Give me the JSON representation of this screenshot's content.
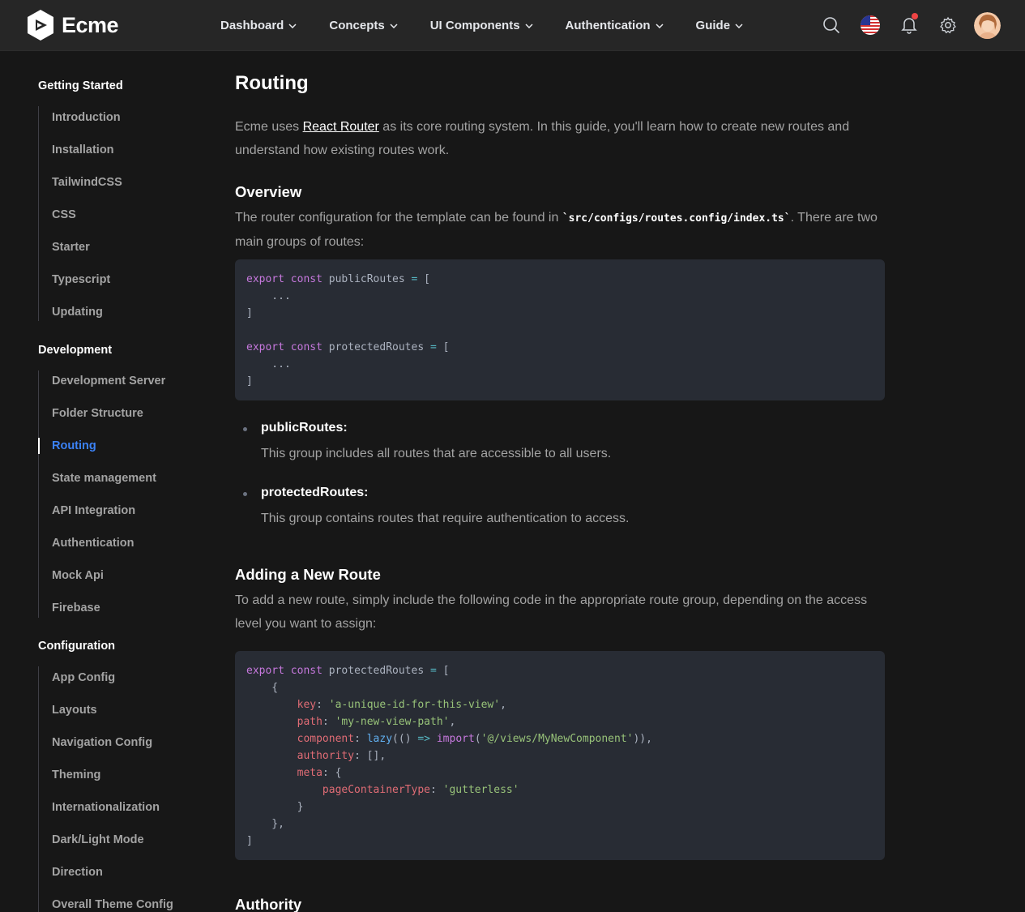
{
  "header": {
    "brand": "Ecme",
    "nav": [
      "Dashboard",
      "Concepts",
      "UI Components",
      "Authentication",
      "Guide"
    ],
    "icons": [
      "search-icon",
      "us-flag-icon",
      "bell-icon",
      "gear-icon",
      "avatar"
    ]
  },
  "sidebar": {
    "sections": [
      {
        "title": "Getting Started",
        "items": [
          "Introduction",
          "Installation",
          "TailwindCSS",
          "CSS",
          "Starter",
          "Typescript",
          "Updating"
        ]
      },
      {
        "title": "Development",
        "items": [
          "Development Server",
          "Folder Structure",
          "Routing",
          "State management",
          "API Integration",
          "Authentication",
          "Mock Api",
          "Firebase"
        ]
      },
      {
        "title": "Configuration",
        "items": [
          "App Config",
          "Layouts",
          "Navigation Config",
          "Theming",
          "Internationalization",
          "Dark/Light Mode",
          "Direction",
          "Overall Theme Config"
        ]
      }
    ],
    "active": "Routing"
  },
  "content": {
    "title": "Routing",
    "intro_pre": "Ecme uses ",
    "intro_link": "React Router",
    "intro_post": " as its core routing system. In this guide, you'll learn how to create new routes and understand how existing routes work.",
    "overview_title": "Overview",
    "overview_pre": "The router configuration for the template can be found in ",
    "overview_code": "`src/configs/routes.config/index.ts`",
    "overview_post": ". There are two main groups of routes:",
    "code1_lines": [
      "export const publicRoutes = [",
      "    ...",
      "]",
      "",
      "export const protectedRoutes = [",
      "    ...",
      "]"
    ],
    "bullets": [
      {
        "title": "publicRoutes:",
        "text": "This group includes all routes that are accessible to all users."
      },
      {
        "title": "protectedRoutes:",
        "text": "This group contains routes that require authentication to access."
      }
    ],
    "new_route_title": "Adding a New Route",
    "new_route_text": "To add a new route, simply include the following code in the appropriate route group, depending on the access level you want to assign:",
    "code2_lines": [
      "export const protectedRoutes = [",
      "    {",
      "        key: 'a-unique-id-for-this-view',",
      "        path: 'my-new-view-path',",
      "        component: lazy(() => import('@/views/MyNewComponent')),",
      "        authority: [],",
      "        meta: {",
      "            pageContainerType: 'gutterless'",
      "        }",
      "    },",
      "]"
    ],
    "authority_title": "Authority"
  },
  "colors": {
    "background": "#171717",
    "header": "#262626",
    "code_bg": "#282c34",
    "active_link": "#3b82f6",
    "keyword": "#c678dd",
    "string": "#98c379",
    "property": "#e06c75"
  }
}
